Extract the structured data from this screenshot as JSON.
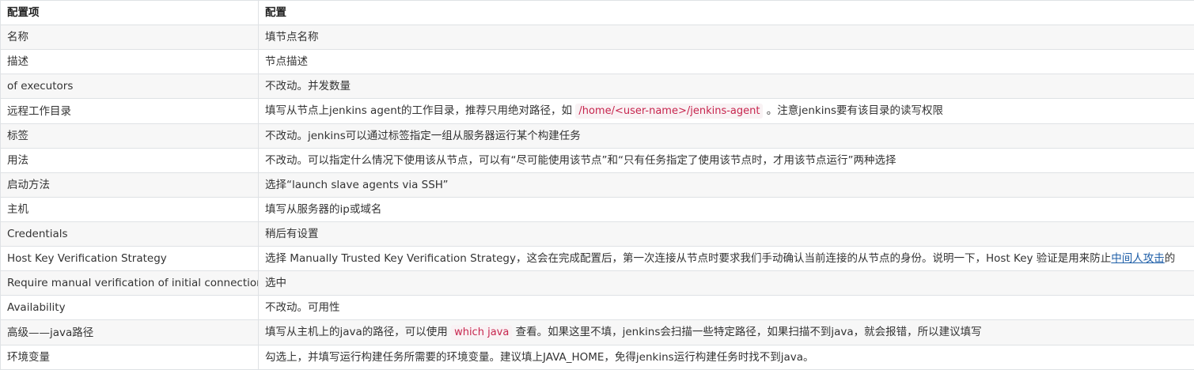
{
  "table": {
    "headers": [
      "配置项",
      "配置"
    ],
    "rows": [
      {
        "item": "名称",
        "value": "填节点名称"
      },
      {
        "item": "描述",
        "value": "节点描述"
      },
      {
        "item": "of executors",
        "value": "不改动。并发数量"
      },
      {
        "item": "远程工作目录",
        "value_before": "填写从节点上jenkins agent的工作目录，推荐只用绝对路径，如 ",
        "code": "/home/<user-name>/jenkins-agent",
        "value_after": " 。注意jenkins要有该目录的读写权限"
      },
      {
        "item": "标签",
        "value": "不改动。jenkins可以通过标签指定一组从服务器运行某个构建任务"
      },
      {
        "item": "用法",
        "value": "不改动。可以指定什么情况下使用该从节点，可以有“尽可能使用该节点”和“只有任务指定了使用该节点时，才用该节点运行”两种选择"
      },
      {
        "item": "启动方法",
        "value": "选择“launch slave agents via SSH”"
      },
      {
        "item": "主机",
        "value": "填写从服务器的ip或域名"
      },
      {
        "item": "Credentials",
        "value": "稍后有设置"
      },
      {
        "item": "Host Key Verification Strategy",
        "value_before": "选择 Manually Trusted Key Verification Strategy，这会在完成配置后，第一次连接从节点时要求我们手动确认当前连接的从节点的身份。说明一下，Host Key 验证是用来防止",
        "link": "中间人攻击",
        "value_after": "的"
      },
      {
        "item": "Require manual verification of initial connection",
        "value": "选中"
      },
      {
        "item": "Availability",
        "value": "不改动。可用性"
      },
      {
        "item": "高级——java路径",
        "value_before": "填写从主机上的java的路径，可以使用 ",
        "code": "which java",
        "value_after": " 查看。如果这里不填，jenkins会扫描一些特定路径，如果扫描不到java，就会报错，所以建议填写"
      },
      {
        "item": "环境变量",
        "value": "勾选上，并填写运行构建任务所需要的环境变量。建议填上JAVA_HOME，免得jenkins运行构建任务时找不到java。"
      }
    ]
  },
  "colors": {
    "border": "#dfe2e5",
    "row_alt": "#f7f7f7",
    "code_text": "#c7254e",
    "link": "#1f5fa8"
  }
}
